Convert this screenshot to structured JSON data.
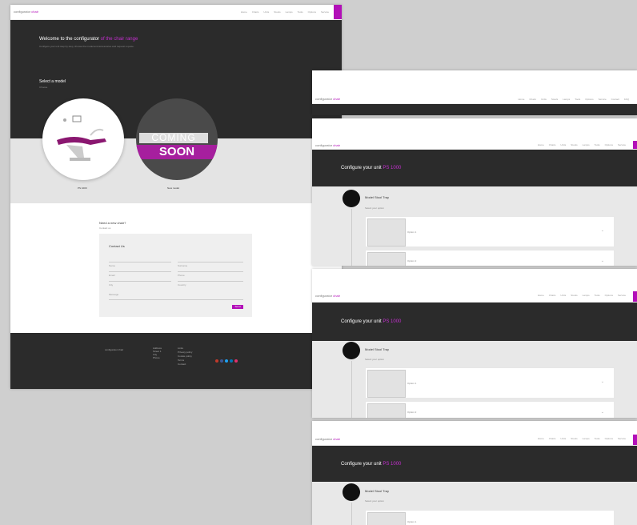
{
  "main": {
    "logo_prefix": "configurator",
    "logo_accent": "chair",
    "nav_items": [
      "Home",
      "Chairs",
      "Units",
      "Stools",
      "Lamps",
      "Tools",
      "Options",
      "Service",
      "Contact",
      "FAQ"
    ],
    "hero_title_prefix": "Welcome to the configurator",
    "hero_title_accent": "of the chair range",
    "hero_sub": "Configure your unit step by step, choose the model and accessories and request a quote.",
    "select_title": "Select a model",
    "select_sub": "Choose",
    "coming_top": "COMING",
    "coming_bottom": "SOON",
    "model1_caption": "PS 1000",
    "model2_caption": "New model",
    "contact_title": "Need a new chair?",
    "contact_sub": "Contact us",
    "form_title": "Contact Us",
    "form_fields": [
      "Name",
      "Surname",
      "Email",
      "Phone",
      "City",
      "Country"
    ],
    "form_message": "Message",
    "send_label": "Send",
    "footer_brand": "configurator chair",
    "footer_col1": [
      "Address",
      "Street 1",
      "City",
      "Phone"
    ],
    "footer_col2": [
      "Links",
      "Privacy policy",
      "Cookie policy",
      "Terms",
      "Contact"
    ],
    "social_colors": [
      "#c0392b",
      "#3b5998",
      "#1da1f2",
      "#0077b5",
      "#e1306c"
    ]
  },
  "config_pages": [
    {
      "title_prefix": "Configure your unit",
      "title_accent": "PS 1000",
      "step_title": "Model Stool Tray",
      "step_sub": "Select your option",
      "items": [
        "Option 1",
        "Option 2"
      ]
    },
    {
      "title_prefix": "Configure your unit",
      "title_accent": "PS 1000",
      "step_title": "Model Stool Tray",
      "step_sub": "Select your option",
      "items": [
        "Option 1",
        "Option 2"
      ]
    },
    {
      "title_prefix": "Configure your unit",
      "title_accent": "PS 1000",
      "step_title": "Model Stool Tray",
      "step_sub": "Select your option",
      "items": [
        "Option 1",
        "Option 2"
      ]
    }
  ],
  "colors": {
    "accent": "#b20fb8",
    "dark": "#2b2b2b",
    "light_band": "#e4e4e4"
  }
}
